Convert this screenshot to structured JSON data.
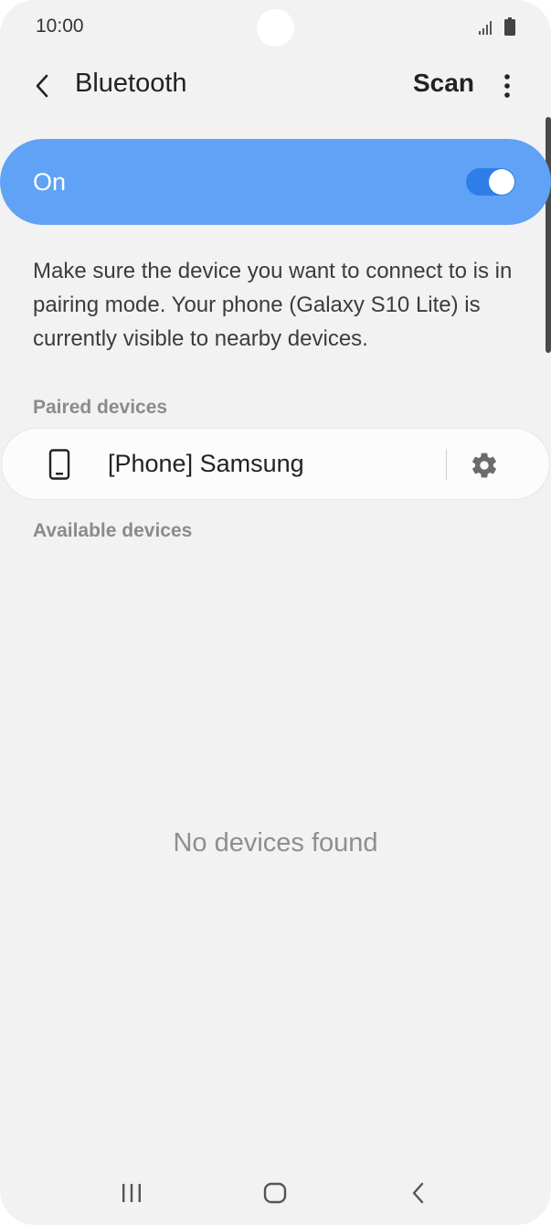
{
  "status_bar": {
    "time": "10:00",
    "icons": [
      "signal-icon",
      "battery-icon"
    ]
  },
  "app_bar": {
    "back_icon": "chevron-left-icon",
    "title": "Bluetooth",
    "scan_label": "Scan",
    "more_icon": "more-vertical-icon"
  },
  "master_switch": {
    "label": "On",
    "enabled": true,
    "accent_color": "#5fa2f6",
    "toggle_color": "#2f7ee8"
  },
  "description": "Make sure the device you want to connect to is in pairing mode. Your phone (Galaxy S10 Lite) is currently visible to nearby devices.",
  "paired": {
    "header": "Paired devices",
    "devices": [
      {
        "name": "[Phone] Samsung",
        "icon": "phone-icon",
        "settings_icon": "gear-icon"
      }
    ]
  },
  "available": {
    "header": "Available devices",
    "empty_message": "No devices found"
  },
  "nav_bar": {
    "buttons": [
      "recents-icon",
      "home-icon",
      "back-icon"
    ]
  }
}
